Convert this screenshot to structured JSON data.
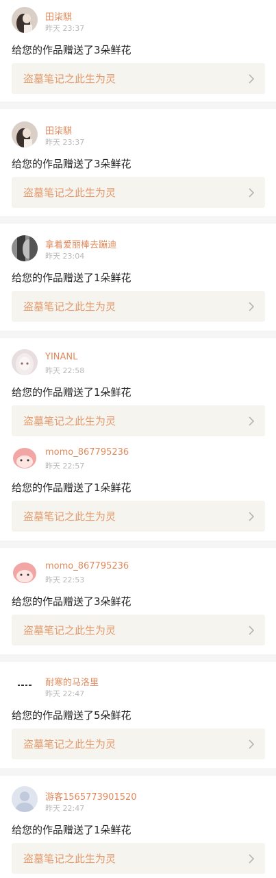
{
  "colors": {
    "name": "#e08a5c",
    "time": "#b9b9b9",
    "work_title": "#e39a6c",
    "work_bg": "#f6f4ee",
    "divider": "#f5f5f5"
  },
  "items": [
    {
      "name": "田柒騏",
      "time": "昨天 23:37",
      "message": "给您的作品赠送了3朵鲜花",
      "work": "盗墓笔记之此生为灵",
      "avatar": "girl-photo-avatar"
    },
    {
      "name": "田柒騏",
      "time": "昨天 23:37",
      "message": "给您的作品赠送了3朵鲜花",
      "work": "盗墓笔记之此生为灵",
      "avatar": "girl-photo-avatar"
    },
    {
      "name": "拿着爱丽棒去蹦迪",
      "time": "昨天 23:04",
      "message": "给您的作品赠送了1朵鲜花",
      "work": "盗墓笔记之此生为灵",
      "avatar": "dark-hair-avatar"
    },
    {
      "name": "YINANL",
      "time": "昨天 22:58",
      "message": "给您的作品赠送了1朵鲜花",
      "work": "盗墓笔记之此生为灵",
      "avatar": "anime-girl-avatar"
    },
    {
      "name": "momo_867795236",
      "time": "昨天 22:57",
      "message": "给您的作品赠送了1朵鲜花",
      "work": "盗墓笔记之此生为灵",
      "avatar": "pink-blob-avatar"
    },
    {
      "name": "momo_867795236",
      "time": "昨天 22:53",
      "message": "给您的作品赠送了3朵鲜花",
      "work": "盗墓笔记之此生为灵",
      "avatar": "pink-blob-avatar"
    },
    {
      "name": "耐寒的马洛里",
      "time": "昨天 22:47",
      "message": "给您的作品赠送了5朵鲜花",
      "work": "盗墓笔记之此生为灵",
      "avatar": "text-avatar"
    },
    {
      "name": "游客1565773901520",
      "time": "昨天 22:47",
      "message": "给您的作品赠送了1朵鲜花",
      "work": "盗墓笔记之此生为灵",
      "avatar": "default-guest-avatar"
    }
  ]
}
